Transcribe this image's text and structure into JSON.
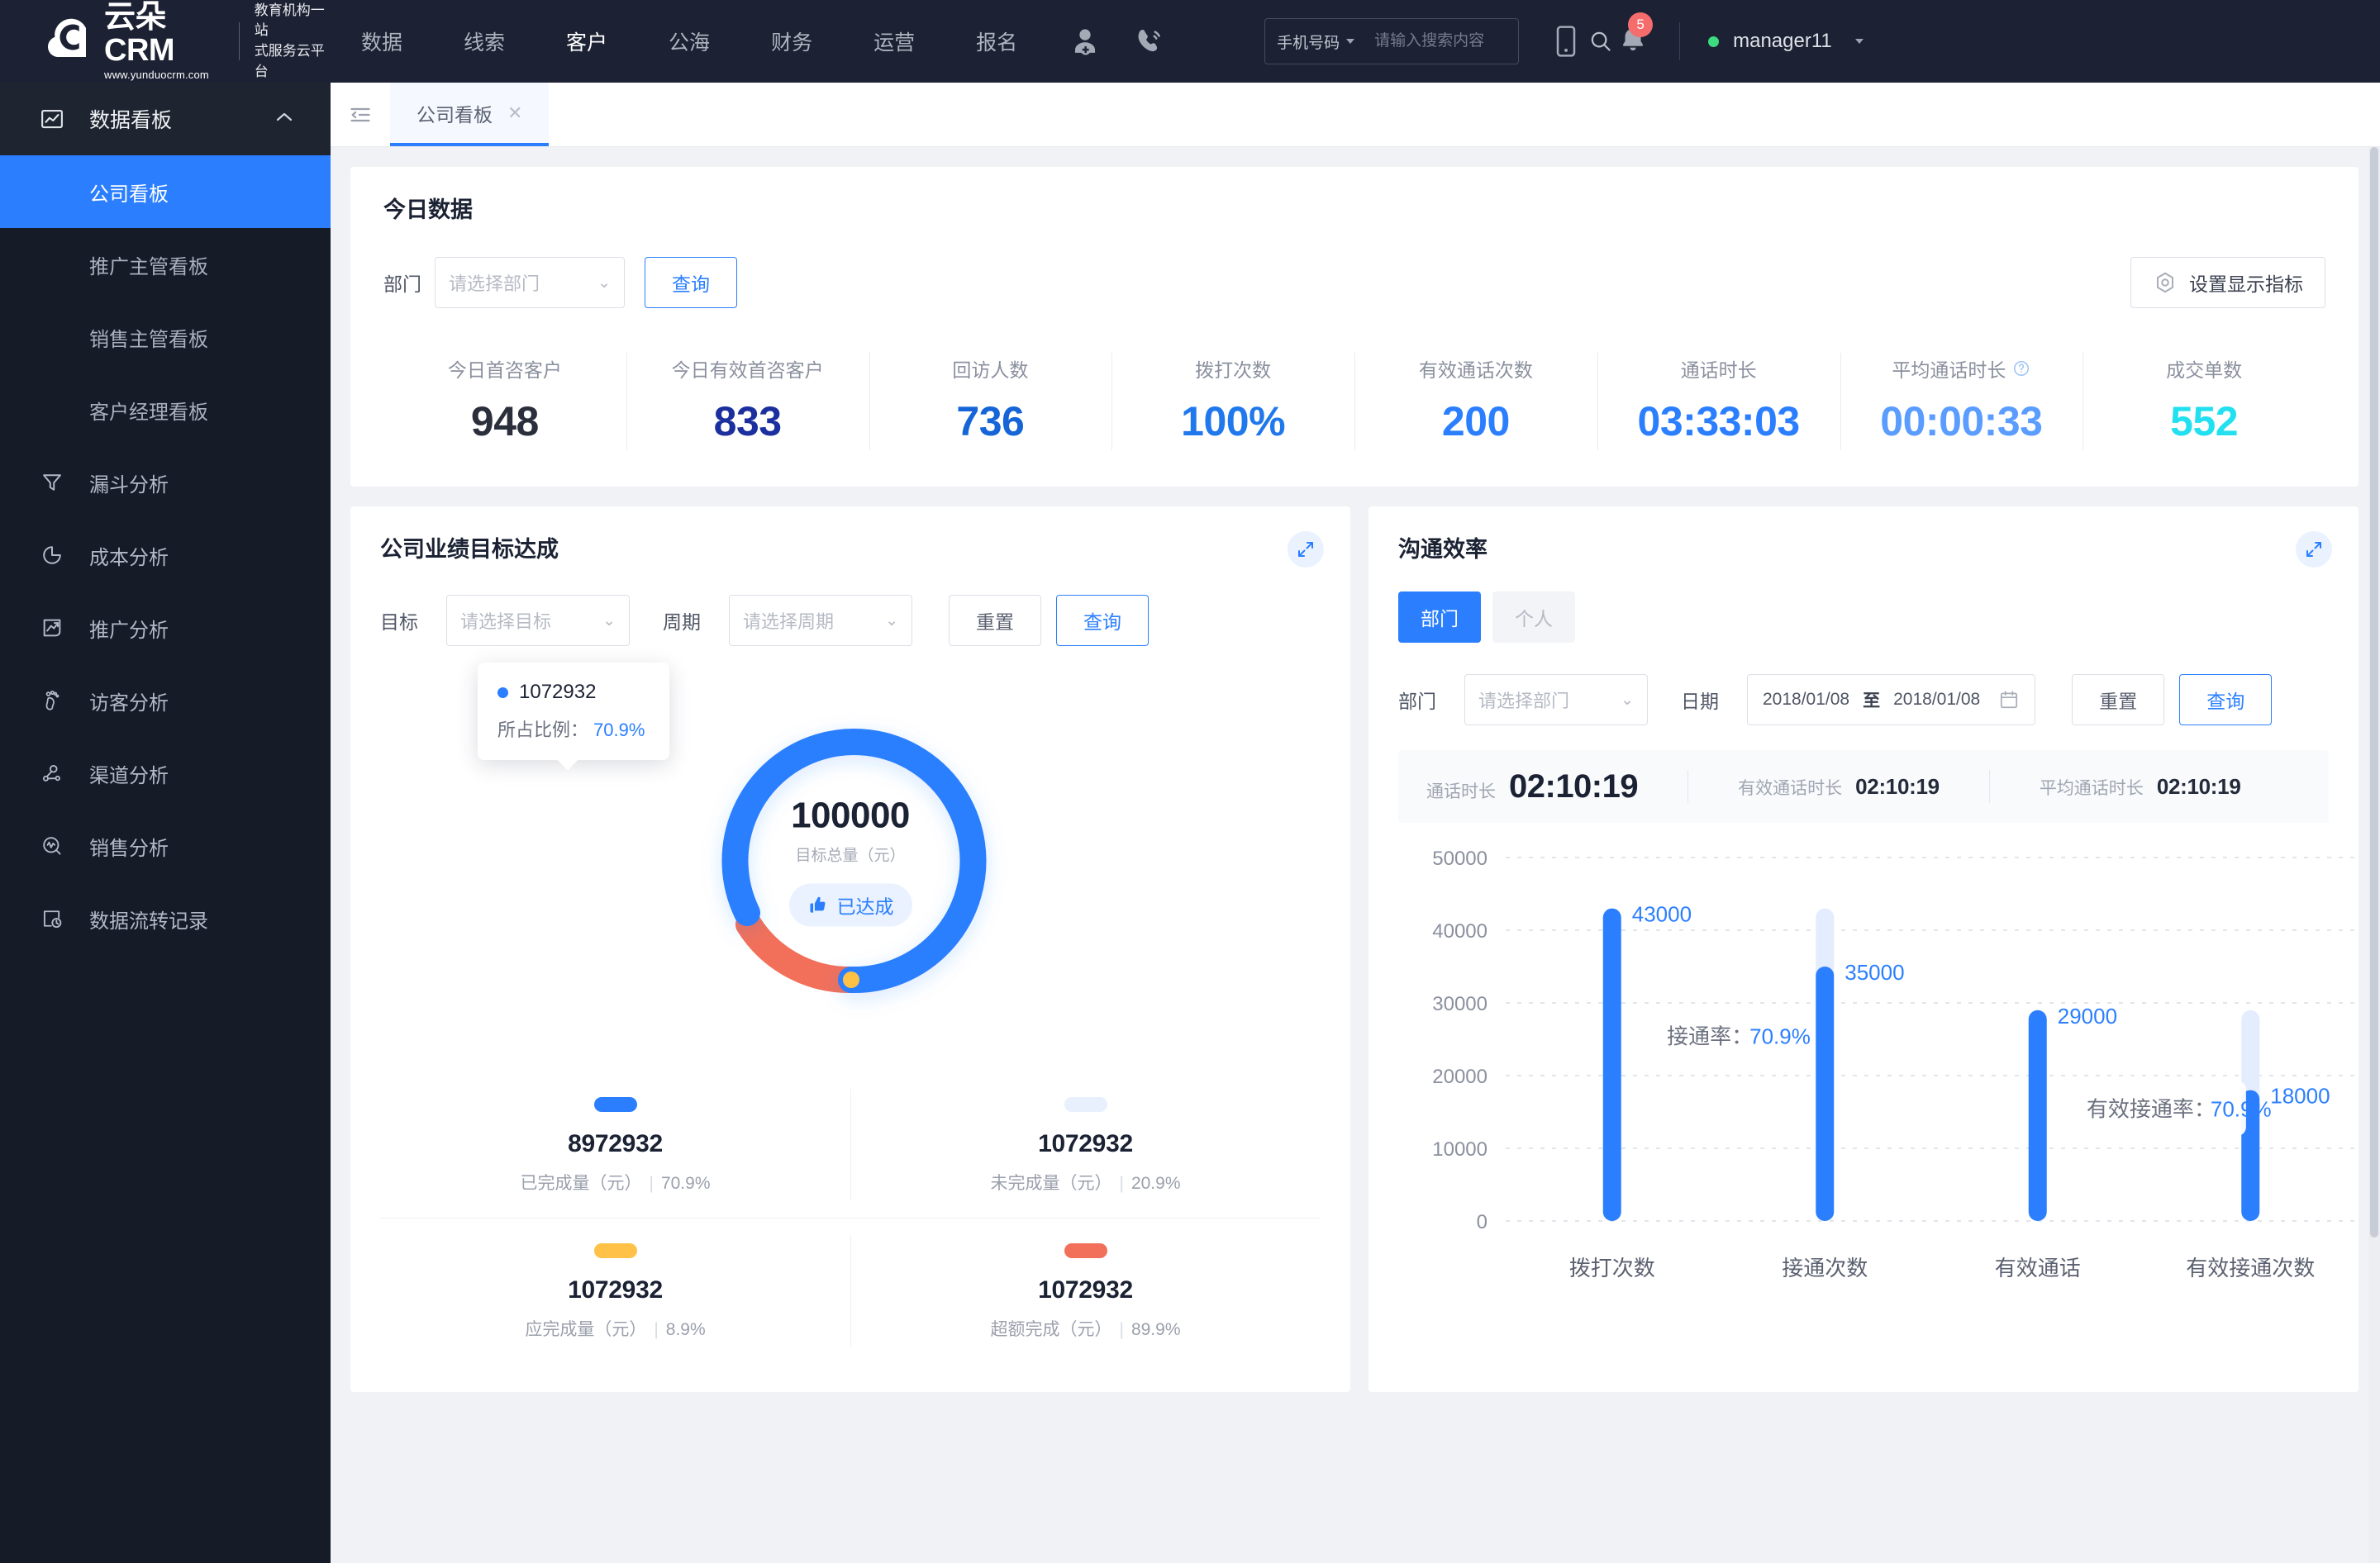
{
  "brand": {
    "name": "云朵CRM",
    "url": "www.yunduocrm.com",
    "slogan_line1": "教育机构一站",
    "slogan_line2": "式服务云平台"
  },
  "topnav": {
    "items": [
      {
        "label": "数据",
        "active": false
      },
      {
        "label": "线索",
        "active": false
      },
      {
        "label": "客户",
        "active": true
      },
      {
        "label": "公海",
        "active": false
      },
      {
        "label": "财务",
        "active": false
      },
      {
        "label": "运营",
        "active": false
      },
      {
        "label": "报名",
        "active": false
      }
    ],
    "icons": [
      "add-user-icon",
      "phone-call-icon"
    ],
    "search": {
      "type_label": "手机号码",
      "placeholder": "请输入搜索内容",
      "value": ""
    },
    "right_icons": [
      "mobile-device-icon",
      "bell-icon"
    ],
    "notification_count": "5",
    "user": {
      "name": "manager11",
      "status_color": "#3ddb7f"
    }
  },
  "sidebar": {
    "group": {
      "label": "数据看板",
      "icon": "dashboard-chart-icon",
      "expanded": true,
      "children": [
        {
          "label": "公司看板",
          "active": true
        },
        {
          "label": "推广主管看板",
          "active": false
        },
        {
          "label": "销售主管看板",
          "active": false
        },
        {
          "label": "客户经理看板",
          "active": false
        }
      ]
    },
    "items": [
      {
        "label": "漏斗分析",
        "icon": "funnel-icon"
      },
      {
        "label": "成本分析",
        "icon": "pie-chart-icon"
      },
      {
        "label": "推广分析",
        "icon": "trend-up-icon"
      },
      {
        "label": "访客分析",
        "icon": "footprint-icon"
      },
      {
        "label": "渠道分析",
        "icon": "network-nodes-icon"
      },
      {
        "label": "销售分析",
        "icon": "pulse-search-icon"
      },
      {
        "label": "数据流转记录",
        "icon": "data-history-icon"
      }
    ]
  },
  "tabbar": {
    "collapse_icon": "collapse-menu-icon",
    "tabs": [
      {
        "label": "公司看板",
        "active": true,
        "close_icon": "close-icon"
      }
    ]
  },
  "today": {
    "title": "今日数据",
    "dept_label": "部门",
    "dept_placeholder": "请选择部门",
    "query_button": "查询",
    "settings_button": "设置显示指标",
    "settings_icon": "gear-hex-icon",
    "kpis": [
      {
        "label": "今日首咨客户",
        "value": "948",
        "color": "#2b2f3b",
        "has_help": false
      },
      {
        "label": "今日有效首咨客户",
        "value": "833",
        "color": "#1c2f9e",
        "has_help": false
      },
      {
        "label": "回访人数",
        "value": "736",
        "color": "#1565d8",
        "has_help": false
      },
      {
        "label": "拨打次数",
        "value": "100%",
        "color": "#1f78ec",
        "has_help": false
      },
      {
        "label": "有效通话次数",
        "value": "200",
        "color": "#2b7fff",
        "has_help": false
      },
      {
        "label": "通话时长",
        "value": "03:33:03",
        "color": "#2b7fff",
        "has_help": false
      },
      {
        "label": "平均通话时长",
        "value": "00:00:33",
        "color": "#5a9dff",
        "has_help": true
      },
      {
        "label": "成交单数",
        "value": "552",
        "color": "#23e0f0",
        "has_help": false
      }
    ]
  },
  "goal_panel": {
    "title": "公司业绩目标达成",
    "expand_icon": "expand-icon",
    "goal_label": "目标",
    "goal_placeholder": "请选择目标",
    "period_label": "周期",
    "period_placeholder": "请选择周期",
    "reset_button": "重置",
    "query_button": "查询",
    "donut": {
      "center_value": "100000",
      "center_sub": "目标总量（元）",
      "status_pill": "已达成",
      "status_icon": "thumbs-up-icon",
      "tooltip": {
        "value": "1072932",
        "ratio_label": "所占比例：",
        "ratio_value": "70.9%",
        "dot_color": "#2b7fff"
      }
    },
    "legend": [
      {
        "color": "#2b7fff",
        "value": "8972932",
        "desc": "已完成量（元）",
        "pct": "70.9%"
      },
      {
        "color": "#e8f0fe",
        "value": "1072932",
        "desc": "未完成量（元）",
        "pct": "20.9%"
      },
      {
        "color": "#ffc247",
        "value": "1072932",
        "desc": "应完成量（元）",
        "pct": "8.9%"
      },
      {
        "color": "#f2705a",
        "value": "1072932",
        "desc": "超额完成（元）",
        "pct": "89.9%"
      }
    ]
  },
  "comm_panel": {
    "title": "沟通效率",
    "expand_icon": "expand-icon",
    "segments": [
      {
        "label": "部门",
        "active": true
      },
      {
        "label": "个人",
        "active": false
      }
    ],
    "dept_label": "部门",
    "dept_placeholder": "请选择部门",
    "date_label": "日期",
    "date_start": "2018/01/08",
    "date_sep": "至",
    "date_end": "2018/01/08",
    "calendar_icon": "calendar-icon",
    "reset_button": "重置",
    "query_button": "查询",
    "durations": [
      {
        "label": "通话时长",
        "value": "02:10:19",
        "emphasis": true
      },
      {
        "label": "有效通话时长",
        "value": "02:10:19",
        "emphasis": false
      },
      {
        "label": "平均通话时长",
        "value": "02:10:19",
        "emphasis": false
      }
    ]
  },
  "chart_data": {
    "type": "bar",
    "title": "沟通效率",
    "categories": [
      "拨打次数",
      "接通次数",
      "有效通话",
      "有效接通次数"
    ],
    "values": [
      43000,
      35000,
      29000,
      18000
    ],
    "value_labels": [
      "43000",
      "35000",
      "29000",
      "18000"
    ],
    "ghost_tops": [
      43000,
      43000,
      29000,
      29000
    ],
    "xlabel": "",
    "ylabel": "",
    "ylim": [
      0,
      50000
    ],
    "yticks": [
      0,
      10000,
      20000,
      30000,
      40000,
      50000
    ],
    "ytick_labels": [
      "0",
      "10000",
      "20000",
      "30000",
      "40000",
      "50000"
    ],
    "grid": true,
    "grid_style": "dashed",
    "bar_color": "#2b7fff",
    "ghost_color": "#e3edfd",
    "label_color": "#2b7fff",
    "legend": [],
    "annotations": [
      {
        "label": "接通率：",
        "value": "70.9%",
        "between": [
          "拨打次数",
          "接通次数"
        ]
      },
      {
        "label": "有效接通率：",
        "value": "70.9%",
        "between": [
          "有效通话",
          "有效接通次数"
        ]
      }
    ]
  }
}
